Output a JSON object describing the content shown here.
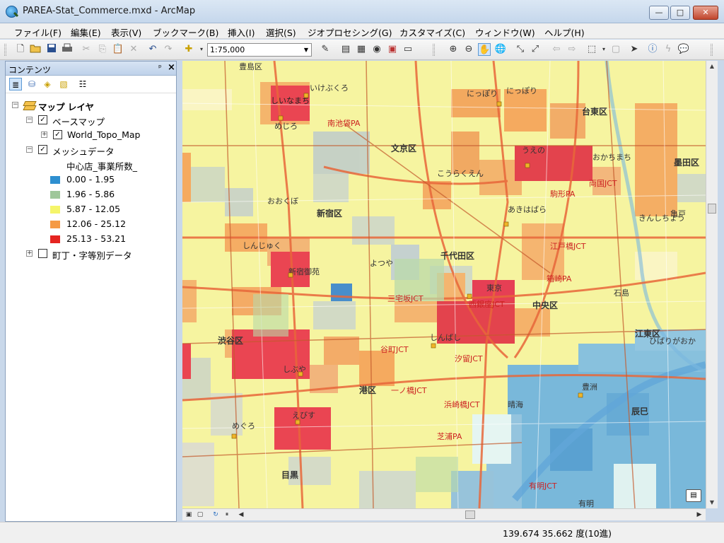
{
  "window": {
    "title": "PAREA-Stat_Commerce.mxd - ArcMap",
    "minimize_label": "—",
    "maximize_label": "□",
    "close_label": "✕"
  },
  "menu": {
    "items": [
      "ファイル(F)",
      "編集(E)",
      "表示(V)",
      "ブックマーク(B)",
      "挿入(I)",
      "選択(S)",
      "ジオプロセシング(G)",
      "カスタマイズ(C)",
      "ウィンドウ(W)",
      "ヘルプ(H)"
    ]
  },
  "toolbar": {
    "scale_value": "1:75,000"
  },
  "toc": {
    "title": "コンテンツ",
    "pin_label": "ᵖ",
    "close_label": "×",
    "root_label": "マップ レイヤ",
    "basemap_group": "ベースマップ",
    "basemap_layer": "World_Topo_Map",
    "mesh_group": "メッシュデータ",
    "field_label": "中心店_事業所数_",
    "legend": [
      {
        "label": "0.00 - 1.95",
        "color": "#2e8fd0"
      },
      {
        "label": "1.96 - 5.86",
        "color": "#9fc79a"
      },
      {
        "label": "5.87 - 12.05",
        "color": "#f5f56a"
      },
      {
        "label": "12.06 - 25.12",
        "color": "#f59a44"
      },
      {
        "label": "25.13 - 53.21",
        "color": "#e52420"
      }
    ],
    "chome_layer": "町丁・字等別データ"
  },
  "map_labels": {
    "places": [
      "豊島区",
      "いけぶくろ",
      "しいなまち",
      "南池袋PA",
      "にっぽり",
      "にっぽり",
      "台東区",
      "めじろ",
      "文京区",
      "うえの",
      "おかちまち",
      "おおくぼ",
      "新宿区",
      "こうらくえん",
      "あきはばら",
      "駒形PA",
      "きんしちょう",
      "しんじゅく",
      "新宿御苑",
      "千代田区",
      "よつや",
      "東京",
      "箱崎PA",
      "中央区",
      "西銀座JCT",
      "しぶや",
      "渋谷区",
      "谷町JCT",
      "しんばし",
      "港区",
      "汐留JCT",
      "晴海",
      "豊洲",
      "辰巳",
      "えびす",
      "目黒",
      "めぐろ",
      "芝浦PA",
      "有明JCT",
      "有明",
      "ひばりがおか",
      "石島",
      "江東区",
      "浜崎橋JCT",
      "一ノ橋JCT",
      "三宅坂JCT",
      "江戸橋JCT",
      "両国JCT",
      "亀戸",
      "墨田区"
    ]
  },
  "status": {
    "coordinates": "139.674  35.662 度(10進)"
  }
}
